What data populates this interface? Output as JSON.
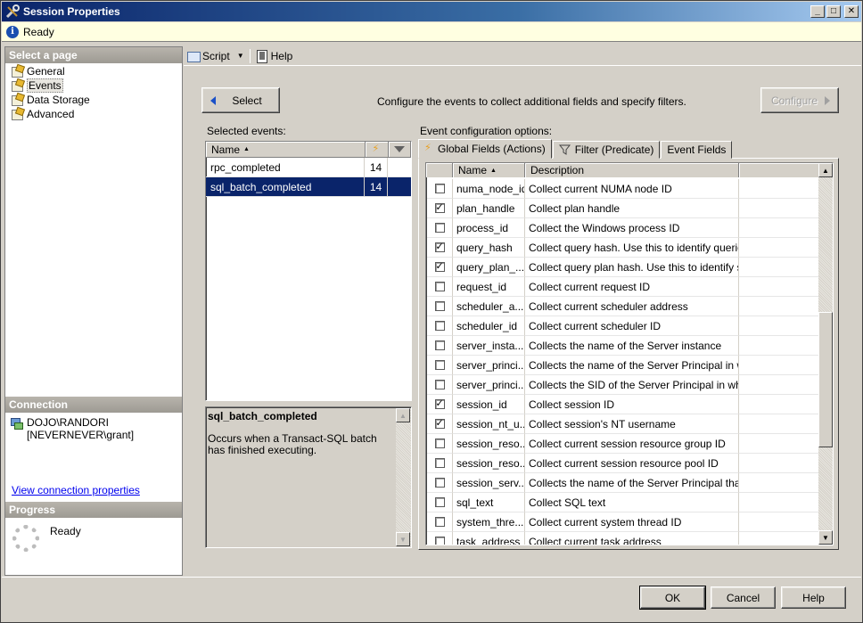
{
  "window": {
    "title": "Session Properties",
    "status": "Ready"
  },
  "left": {
    "select_page_header": "Select a page",
    "pages": [
      {
        "label": "General",
        "selected": false
      },
      {
        "label": "Events",
        "selected": true
      },
      {
        "label": "Data Storage",
        "selected": false
      },
      {
        "label": "Advanced",
        "selected": false
      }
    ],
    "connection_header": "Connection",
    "connection_server": "DOJO\\RANDORI",
    "connection_user": "[NEVERNEVER\\grant]",
    "connection_link": "View connection properties",
    "progress_header": "Progress",
    "progress_status": "Ready"
  },
  "toolbar": {
    "script_label": "Script",
    "help_label": "Help"
  },
  "main": {
    "select_button": "Select",
    "description": "Configure the events to collect additional fields and specify filters.",
    "configure_button": "Configure",
    "selected_events_label": "Selected events:",
    "events_header_name": "Name",
    "events": [
      {
        "name": "rpc_completed",
        "count": "14",
        "selected": false
      },
      {
        "name": "sql_batch_completed",
        "count": "14",
        "selected": true
      }
    ],
    "event_desc_title": "sql_batch_completed",
    "event_desc_text": "Occurs when a Transact-SQL batch has finished executing.",
    "config_label": "Event configuration options:",
    "tabs": [
      "Global Fields (Actions)",
      "Filter (Predicate)",
      "Event Fields"
    ],
    "grid_header_name": "Name",
    "grid_header_desc": "Description",
    "fields": [
      {
        "name": "numa_node_id",
        "desc": "Collect current NUMA node ID",
        "checked": false
      },
      {
        "name": "plan_handle",
        "desc": "Collect plan handle",
        "checked": true
      },
      {
        "name": "process_id",
        "desc": "Collect the Windows process ID",
        "checked": false
      },
      {
        "name": "query_hash",
        "desc": "Collect query hash. Use this to identify querie...",
        "checked": true
      },
      {
        "name": "query_plan_...",
        "desc": "Collect query plan hash. Use this to identify si...",
        "checked": true
      },
      {
        "name": "request_id",
        "desc": "Collect current request ID",
        "checked": false
      },
      {
        "name": "scheduler_a...",
        "desc": "Collect current scheduler address",
        "checked": false
      },
      {
        "name": "scheduler_id",
        "desc": "Collect current scheduler ID",
        "checked": false
      },
      {
        "name": "server_insta...",
        "desc": "Collects the name of the Server instance",
        "checked": false
      },
      {
        "name": "server_princi...",
        "desc": "Collects the name of the Server Principal in wh...",
        "checked": false
      },
      {
        "name": "server_princi...",
        "desc": "Collects the SID of the Server Principal in who...",
        "checked": false
      },
      {
        "name": "session_id",
        "desc": "Collect session ID",
        "checked": true
      },
      {
        "name": "session_nt_u...",
        "desc": "Collect session's NT username",
        "checked": true
      },
      {
        "name": "session_reso...",
        "desc": "Collect current session resource group ID",
        "checked": false
      },
      {
        "name": "session_reso...",
        "desc": "Collect current session resource pool ID",
        "checked": false
      },
      {
        "name": "session_serv...",
        "desc": "Collects the name of the Server Principal that ...",
        "checked": false
      },
      {
        "name": "sql_text",
        "desc": "Collect SQL text",
        "checked": false
      },
      {
        "name": "system_thre...",
        "desc": "Collect current system thread ID",
        "checked": false
      },
      {
        "name": "task_address",
        "desc": "Collect current task address",
        "checked": false
      }
    ]
  },
  "footer": {
    "ok": "OK",
    "cancel": "Cancel",
    "help": "Help"
  }
}
